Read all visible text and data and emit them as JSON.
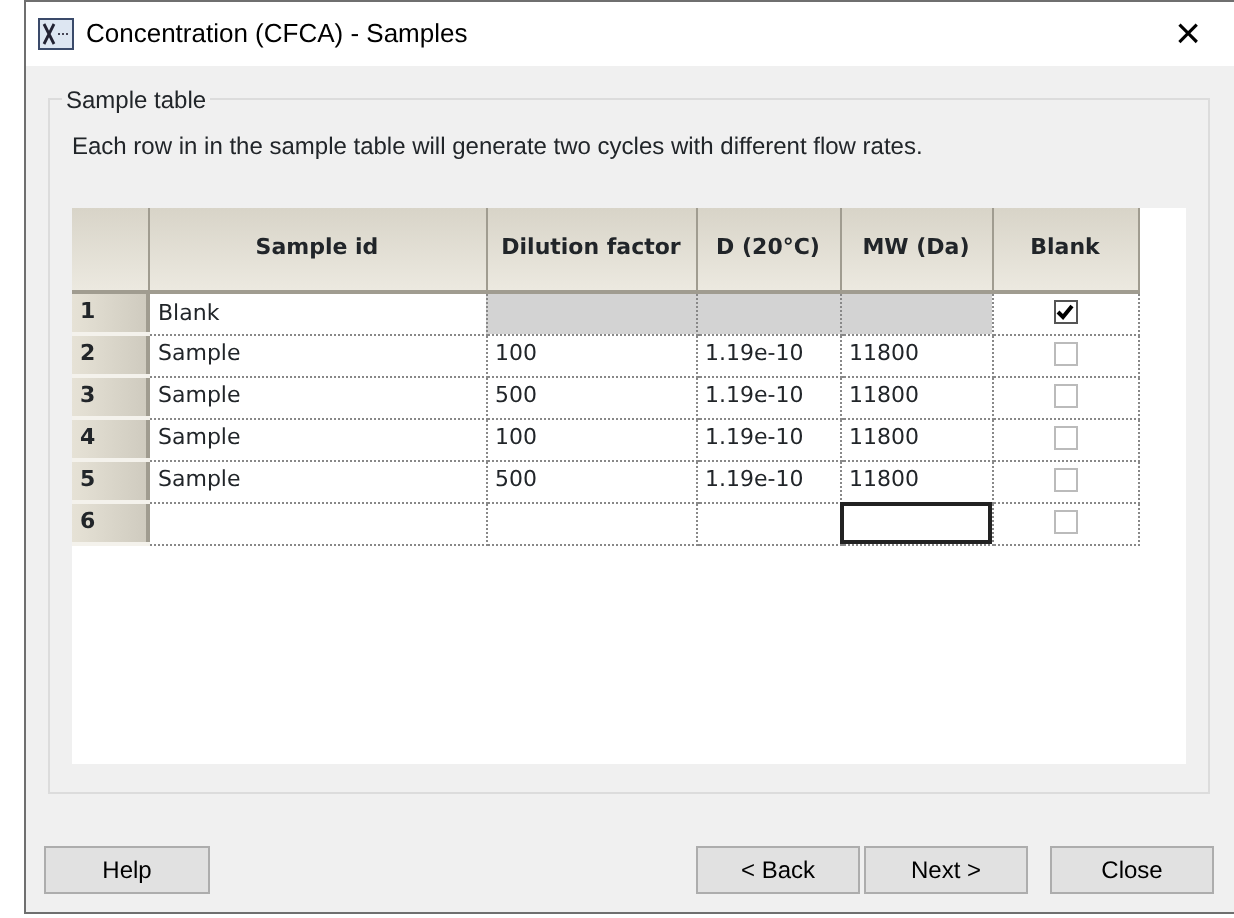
{
  "window": {
    "title": "Concentration (CFCA) - Samples",
    "close": "×"
  },
  "group": {
    "title": "Sample table",
    "description": "Each row in in the sample table will generate two cycles with different flow rates."
  },
  "table": {
    "columns": [
      "Sample id",
      "Dilution factor",
      "D (20°C)",
      "MW (Da)",
      "Blank"
    ],
    "rows": [
      {
        "number": "1",
        "cells": [
          "Blank",
          "",
          "",
          ""
        ],
        "disabled": true,
        "blank": true,
        "selected": false
      },
      {
        "number": "2",
        "cells": [
          "Sample",
          "100",
          "1.19e-10",
          "11800"
        ],
        "disabled": false,
        "blank": false,
        "selected": false
      },
      {
        "number": "3",
        "cells": [
          "Sample",
          "500",
          "1.19e-10",
          "11800"
        ],
        "disabled": false,
        "blank": false,
        "selected": false
      },
      {
        "number": "4",
        "cells": [
          "Sample",
          "100",
          "1.19e-10",
          "11800"
        ],
        "disabled": false,
        "blank": false,
        "selected": false
      },
      {
        "number": "5",
        "cells": [
          "Sample",
          "500",
          "1.19e-10",
          "11800"
        ],
        "disabled": false,
        "blank": false,
        "selected": false
      },
      {
        "number": "6",
        "cells": [
          "",
          "",
          "",
          ""
        ],
        "disabled": false,
        "blank": false,
        "selected": true
      }
    ]
  },
  "buttons": [
    {
      "label": "Help",
      "kind": "left"
    },
    {
      "label": "< Back",
      "kind": "right"
    },
    {
      "label": "Next >",
      "kind": "right"
    },
    {
      "label": "Close",
      "kind": "far"
    }
  ]
}
